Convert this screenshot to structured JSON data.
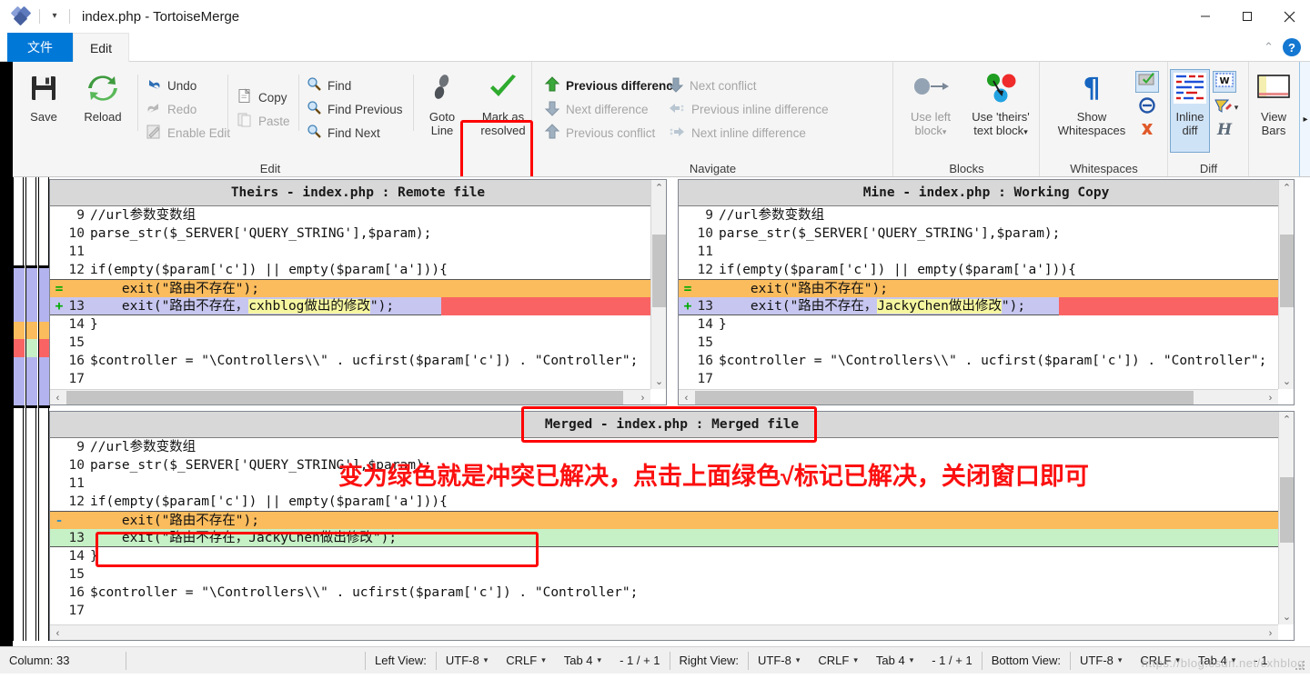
{
  "window": {
    "title": "index.php - TortoiseMerge",
    "app_icon": "tortoisemerge-icon",
    "quick_access_caret": "▾",
    "controls": {
      "minimize": "minimize-icon",
      "maximize": "maximize-icon",
      "close": "close-icon"
    }
  },
  "menu": {
    "tabs": [
      {
        "label": "文件",
        "active": true
      },
      {
        "label": "Edit",
        "active": false
      }
    ],
    "collapse_label": "⌃",
    "help_label": "?"
  },
  "ribbon": {
    "groups": [
      {
        "title": "Edit",
        "big_buttons": [
          {
            "label": "Save",
            "icon": "save-icon",
            "disabled": false
          },
          {
            "label": "Reload",
            "icon": "reload-icon",
            "disabled": false
          },
          {
            "label": "Goto\nLine",
            "line1": "Goto",
            "line2": "Line",
            "icon": "goto-line-icon",
            "disabled": false
          },
          {
            "line1": "Mark as",
            "line2": "resolved",
            "icon": "mark-resolved-icon",
            "disabled": false,
            "highlighted": true
          }
        ],
        "small_buttons": [
          {
            "label": "Undo",
            "icon": "undo-icon",
            "disabled": false
          },
          {
            "label": "Redo",
            "icon": "redo-icon",
            "disabled": true
          },
          {
            "label": "Enable Edit",
            "icon": "enable-edit-icon",
            "disabled": true
          },
          {
            "label": "Copy",
            "icon": "copy-icon",
            "disabled": false
          },
          {
            "label": "Paste",
            "icon": "paste-icon",
            "disabled": true
          },
          {
            "label": "Find",
            "icon": "find-icon",
            "disabled": false
          },
          {
            "label": "Find Previous",
            "icon": "find-previous-icon",
            "disabled": false
          },
          {
            "label": "Find Next",
            "icon": "find-next-icon",
            "disabled": false
          }
        ]
      },
      {
        "title": "Navigate",
        "small_buttons": [
          {
            "label": "Previous difference",
            "icon": "arrow-up-green-icon",
            "disabled": false
          },
          {
            "label": "Next difference",
            "icon": "arrow-down-gray-icon",
            "disabled": true
          },
          {
            "label": "Previous conflict",
            "icon": "arrow-up-gray-icon",
            "disabled": true
          },
          {
            "label": "Next conflict",
            "icon": "arrow-down-gray-icon",
            "disabled": true
          },
          {
            "label": "Previous inline difference",
            "icon": "arrow-left-inline-icon",
            "disabled": true
          },
          {
            "label": "Next inline difference",
            "icon": "arrow-right-inline-icon",
            "disabled": true
          }
        ]
      },
      {
        "title": "Blocks",
        "big_buttons": [
          {
            "line1": "Use left",
            "line2": "block",
            "icon": "use-left-block-icon",
            "disabled": true,
            "caret": "▾"
          },
          {
            "line1": "Use 'theirs'",
            "line2": "text block",
            "icon": "use-theirs-text-block-icon",
            "disabled": false,
            "caret": "▾"
          }
        ]
      },
      {
        "title": "Whitespaces",
        "big_buttons": [
          {
            "line1": "Show",
            "line2": "Whitespaces",
            "icon": "pilcrow-icon",
            "disabled": false
          }
        ],
        "small_icons": [
          {
            "icon": "whitespace-check-icon",
            "toggled": true
          },
          {
            "icon": "whitespace-ignore-icon",
            "toggled": false
          },
          {
            "icon": "whitespace-remove-icon",
            "toggled": false
          }
        ]
      },
      {
        "title": "Diff",
        "big_buttons": [
          {
            "line1": "Inline",
            "line2": "diff",
            "icon": "inline-diff-icon",
            "disabled": false,
            "toggled": true
          }
        ],
        "small_icons": [
          {
            "icon": "diff-words-icon",
            "toggled": true
          },
          {
            "icon": "diff-highlight-icon",
            "toggled": false,
            "caret": "▾"
          },
          {
            "icon": "diff-script-icon",
            "toggled": false
          }
        ]
      },
      {
        "title": "",
        "big_buttons": [
          {
            "line1": "View",
            "line2": "Bars",
            "icon": "view-bars-icon",
            "disabled": false,
            "caret": "▸"
          }
        ]
      }
    ]
  },
  "panes": {
    "left": {
      "title": "Theirs - index.php : Remote file",
      "name": "theirs-pane",
      "rows": [
        {
          "num": "9",
          "marker": "",
          "text": "//url参数变数组",
          "bg": "white"
        },
        {
          "num": "10",
          "marker": "",
          "text": "parse_str($_SERVER['QUERY_STRING'],$param);",
          "bg": "white"
        },
        {
          "num": "11",
          "marker": "",
          "text": "",
          "bg": "white"
        },
        {
          "num": "12",
          "marker": "",
          "text": "if(empty($param['c']) || empty($param['a'])){",
          "bg": "white"
        },
        {
          "num": "",
          "marker": "=",
          "text": "    exit(\"路由不存在\");",
          "bg": "orange"
        },
        {
          "num": "13",
          "marker": "+",
          "pre": "    exit(\"路由不存在，",
          "hl": "cxhblog做出的修改",
          "post": "\");",
          "bg": "lavender",
          "redfill": true
        },
        {
          "num": "14",
          "marker": "",
          "text": "}",
          "bg": "white"
        },
        {
          "num": "15",
          "marker": "",
          "text": "",
          "bg": "white"
        },
        {
          "num": "16",
          "marker": "",
          "text": "$controller = \"\\Controllers\\\\\" . ucfirst($param['c']) . \"Controller\";",
          "bg": "white"
        },
        {
          "num": "17",
          "marker": "",
          "text": "",
          "bg": "white"
        }
      ]
    },
    "right": {
      "title": "Mine - index.php : Working Copy",
      "name": "mine-pane",
      "rows": [
        {
          "num": "9",
          "marker": "",
          "text": "//url参数变数组",
          "bg": "white"
        },
        {
          "num": "10",
          "marker": "",
          "text": "parse_str($_SERVER['QUERY_STRING'],$param);",
          "bg": "white"
        },
        {
          "num": "11",
          "marker": "",
          "text": "",
          "bg": "white"
        },
        {
          "num": "12",
          "marker": "",
          "text": "if(empty($param['c']) || empty($param['a'])){",
          "bg": "white"
        },
        {
          "num": "",
          "marker": "=",
          "text": "    exit(\"路由不存在\");",
          "bg": "orange"
        },
        {
          "num": "13",
          "marker": "+",
          "pre": "    exit(\"路由不存在，",
          "hl": "JackyChen做出修改",
          "post": "\");",
          "bg": "lavender",
          "redfill": true
        },
        {
          "num": "14",
          "marker": "",
          "text": "}",
          "bg": "white"
        },
        {
          "num": "15",
          "marker": "",
          "text": "",
          "bg": "white"
        },
        {
          "num": "16",
          "marker": "",
          "text": "$controller = \"\\Controllers\\\\\" . ucfirst($param['c']) . \"Controller\";",
          "bg": "white"
        },
        {
          "num": "17",
          "marker": "",
          "text": "",
          "bg": "white"
        }
      ]
    },
    "merged": {
      "title": "Merged - index.php : Merged file",
      "name": "merged-pane",
      "rows": [
        {
          "num": "9",
          "marker": "",
          "text": "//url参数变数组",
          "bg": "white"
        },
        {
          "num": "10",
          "marker": "",
          "text": "parse_str($_SERVER['QUERY_STRING'],$param);",
          "bg": "white"
        },
        {
          "num": "11",
          "marker": "",
          "text": "",
          "bg": "white"
        },
        {
          "num": "12",
          "marker": "",
          "text": "if(empty($param['c']) || empty($param['a'])){",
          "bg": "white"
        },
        {
          "num": "",
          "marker": "-",
          "text": "    exit(\"路由不存在\");",
          "bg": "orange"
        },
        {
          "num": "13",
          "marker": "",
          "text": "    exit(\"路由不存在，JackyChen做出修改\");",
          "bg": "green"
        },
        {
          "num": "14",
          "marker": "",
          "text": "}",
          "bg": "white"
        },
        {
          "num": "15",
          "marker": "",
          "text": "",
          "bg": "white"
        },
        {
          "num": "16",
          "marker": "",
          "text": "$controller = \"\\Controllers\\\\\" . ucfirst($param['c']) . \"Controller\";",
          "bg": "white"
        },
        {
          "num": "17",
          "marker": "",
          "text": "",
          "bg": "white"
        }
      ]
    }
  },
  "annotation": {
    "text": "变为绿色就是冲突已解决，点击上面绿色√标记已解决，关闭窗口即可",
    "color": "#fc1010"
  },
  "statusbar": {
    "column_label": "Column: 33",
    "views": [
      {
        "label": "Left View:",
        "encoding": "UTF-8",
        "eol": "CRLF",
        "tab": "Tab 4",
        "counts": "- 1 / + 1"
      },
      {
        "label": "Right View:",
        "encoding": "UTF-8",
        "eol": "CRLF",
        "tab": "Tab 4",
        "counts": "- 1 / + 1"
      },
      {
        "label": "Bottom View:",
        "encoding": "UTF-8",
        "eol": "CRLF",
        "tab": "Tab 4",
        "counts": "- 1"
      }
    ],
    "caret": "▾",
    "watermark": "https://blog.csdn.net/cxhblog"
  }
}
